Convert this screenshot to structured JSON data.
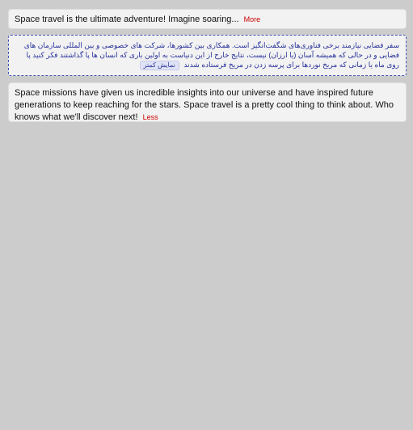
{
  "cards": [
    {
      "text": "Space travel is the ultimate adventure! Imagine soaring...",
      "toggle": "More"
    },
    {
      "text": "سفر فضایی نیازمند برخی فناوری‌های شگفت‌انگیز است. همکاری بین کشورها، شرکت های خصوصی و بین المللی سازمان های فضایی و در حالی که همیشه آسان (یا ارزان) نیست، نتایج خارج از این دنیاست به اولین باری که انسان ها پا گذاشتند فکر کنید پا روی ماه یا زمانی که مریخ نوردها برای پرسه زدن در مریخ فرستاده شدند",
      "toggle": "نمایش کمتر"
    },
    {
      "text": "Space missions have given us incredible insights into our universe and have inspired future generations to keep reaching for the stars. Space travel is a pretty cool thing to think about. Who knows what we'll discover next!",
      "toggle": "Less"
    }
  ],
  "colors": {
    "background": "#cccccc",
    "card": "#f2f2f2",
    "link": "#cc0000",
    "rtl_text": "#26309a",
    "rtl_border": "#3f51b5"
  }
}
